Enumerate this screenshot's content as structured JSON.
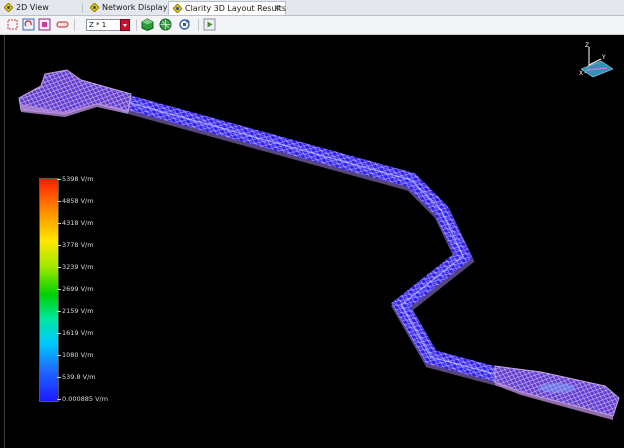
{
  "tabs": [
    {
      "label": "2D View",
      "icon": "view-2d-icon",
      "active": false
    },
    {
      "label": "Network Display",
      "icon": "network-icon",
      "active": false
    },
    {
      "label": "Clarity 3D Layout Results",
      "icon": "clarity-3d-icon",
      "active": true,
      "close": "✕"
    }
  ],
  "toolbar": {
    "zoom_select_value": "Z * 1",
    "buttons": [
      "select-box-icon",
      "rotate-view-icon",
      "fit-view-icon",
      "shape-select-icon",
      "solid-view-icon",
      "mesh-view-icon",
      "refresh-view-icon",
      "play-icon"
    ]
  },
  "axes": {
    "z": "Z",
    "x": "X",
    "y": "Y"
  },
  "legend": {
    "labels": [
      "5398 V/m",
      "4858 V/m",
      "4318 V/m",
      "3778 V/m",
      "3239 V/m",
      "2699 V/m",
      "2159 V/m",
      "1619 V/m",
      "1080 V/m",
      "539.8 V/m",
      "0.000885 V/m"
    ],
    "colors": {
      "max": "#ff1a00",
      "min": "#1a1aff"
    }
  },
  "trace_colors": {
    "mesh": "#3b2cff",
    "wire": "#b7a8ff",
    "ends": "#d7a3d8"
  }
}
